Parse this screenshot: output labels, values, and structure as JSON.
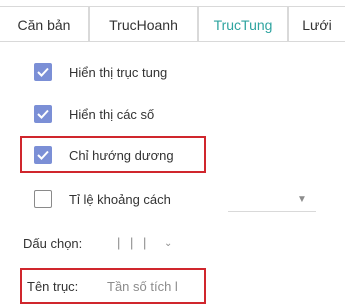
{
  "tabs": [
    {
      "label": "Căn bản"
    },
    {
      "label": "TrucHoanh"
    },
    {
      "label": "TrucTung",
      "active": true
    },
    {
      "label": "Lưới"
    }
  ],
  "options": [
    {
      "label": "Hiển thị trục tung",
      "checked": true
    },
    {
      "label": "Hiển thị các số",
      "checked": true
    },
    {
      "label": "Chỉ hướng dương",
      "checked": true
    },
    {
      "label": "Tỉ lệ khoảng cách",
      "checked": false
    }
  ],
  "marker": {
    "label": "Dấu chọn:",
    "value": "| | |"
  },
  "axis_name": {
    "label": "Tên trục:",
    "value": "Tần số tích l"
  },
  "colors": {
    "accent": "#2fa4a0",
    "checkbox": "#7b8fd6",
    "highlight": "#d0262d"
  },
  "icons": {
    "checkbox_check": "check-icon",
    "dropdown": "chevron-down-icon"
  }
}
